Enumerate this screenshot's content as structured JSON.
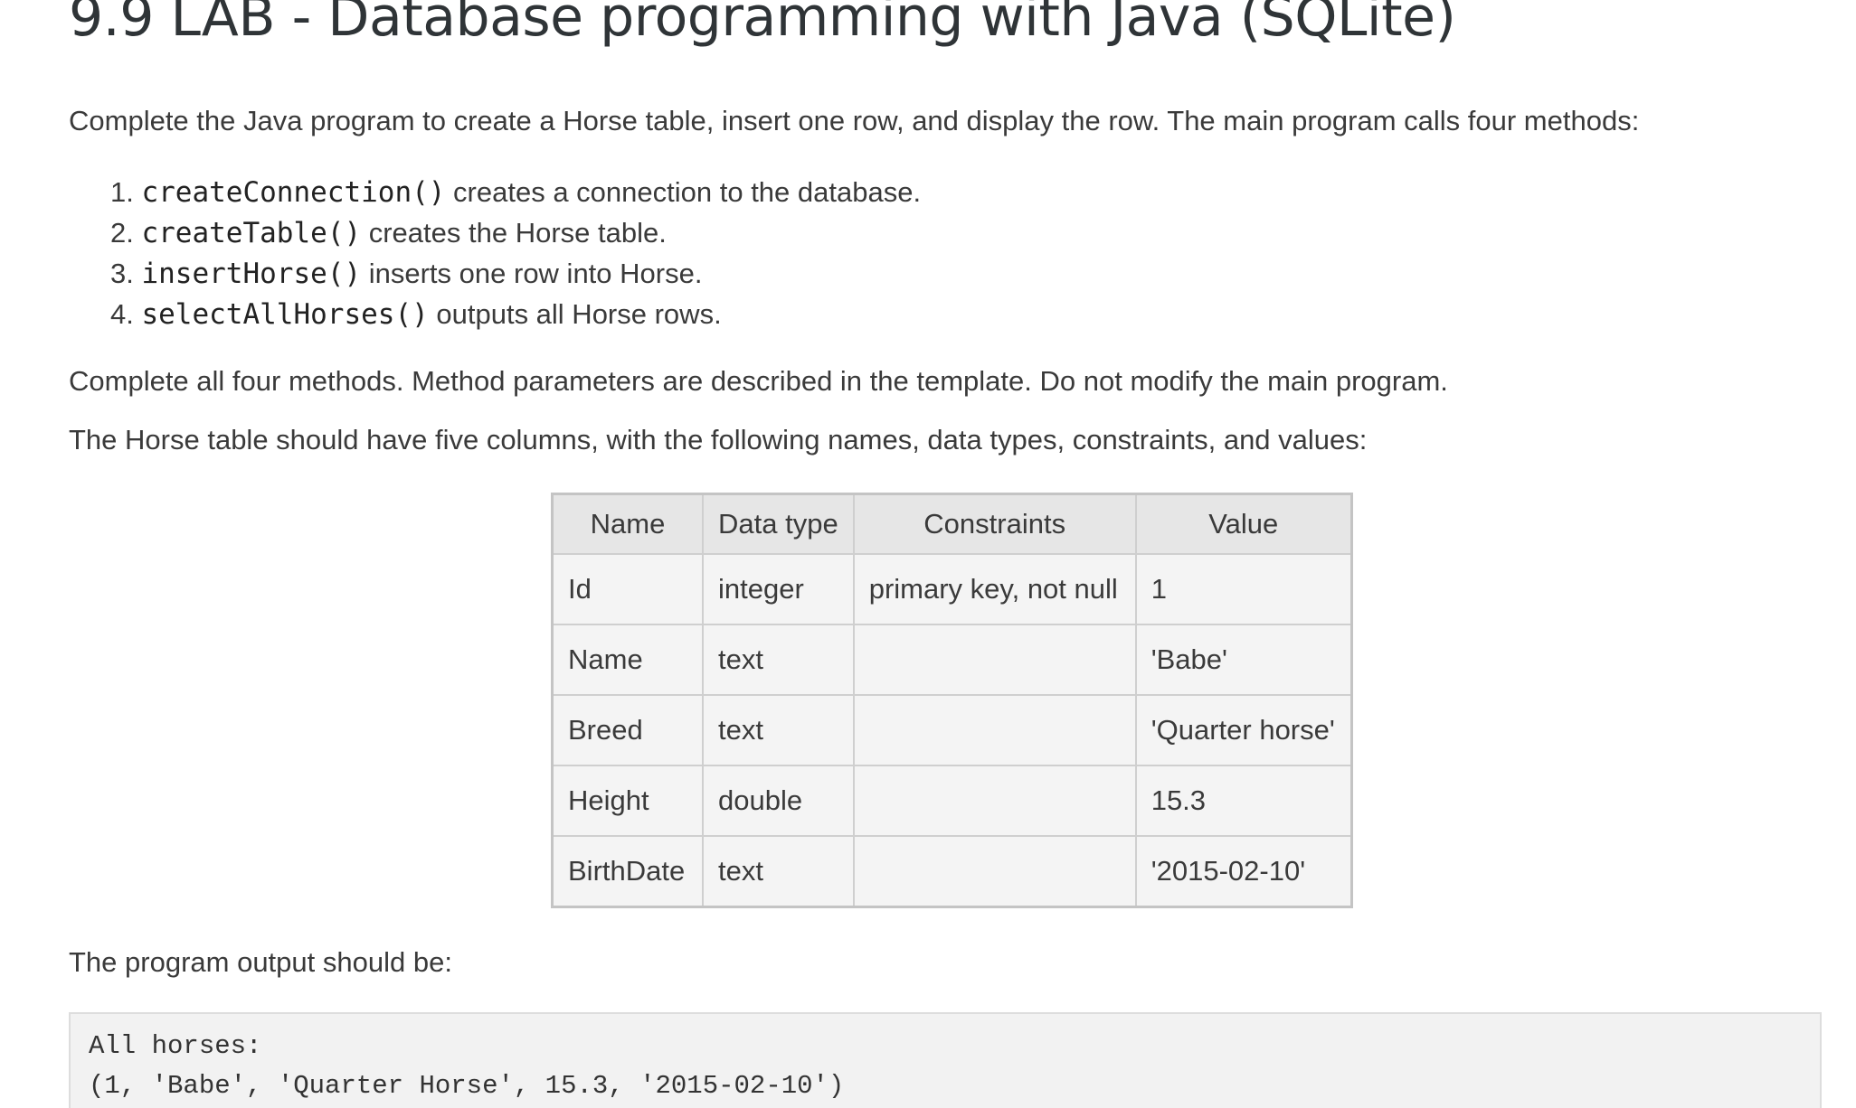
{
  "title": "9.9 LAB - Database programming with Java (SQLite)",
  "intro": "Complete the Java program to create a Horse table, insert one row, and display the row. The main program calls four methods:",
  "steps": [
    {
      "num": "1.",
      "code": "createConnection()",
      "text": " creates a connection to the database."
    },
    {
      "num": "2.",
      "code": "createTable()",
      "text": " creates the Horse table."
    },
    {
      "num": "3.",
      "code": "insertHorse()",
      "text": " inserts one row into Horse."
    },
    {
      "num": "4.",
      "code": "selectAllHorses()",
      "text": " outputs all Horse rows."
    }
  ],
  "complete_note": "Complete all four methods. Method parameters are described in the template. Do not modify the main program.",
  "table_note": "The Horse table should have five columns, with the following names, data types, constraints, and values:",
  "table": {
    "headers": [
      "Name",
      "Data type",
      "Constraints",
      "Value"
    ],
    "rows": [
      [
        "Id",
        "integer",
        "primary key, not null",
        "1"
      ],
      [
        "Name",
        "text",
        "",
        "'Babe'"
      ],
      [
        "Breed",
        "text",
        "",
        "'Quarter horse'"
      ],
      [
        "Height",
        "double",
        "",
        "15.3"
      ],
      [
        "BirthDate",
        "text",
        "",
        "'2015-02-10'"
      ]
    ]
  },
  "output_note": "The program output should be:",
  "output_lines": [
    "All horses:",
    "(1, 'Babe', 'Quarter Horse', 15.3, '2015-02-10')"
  ]
}
